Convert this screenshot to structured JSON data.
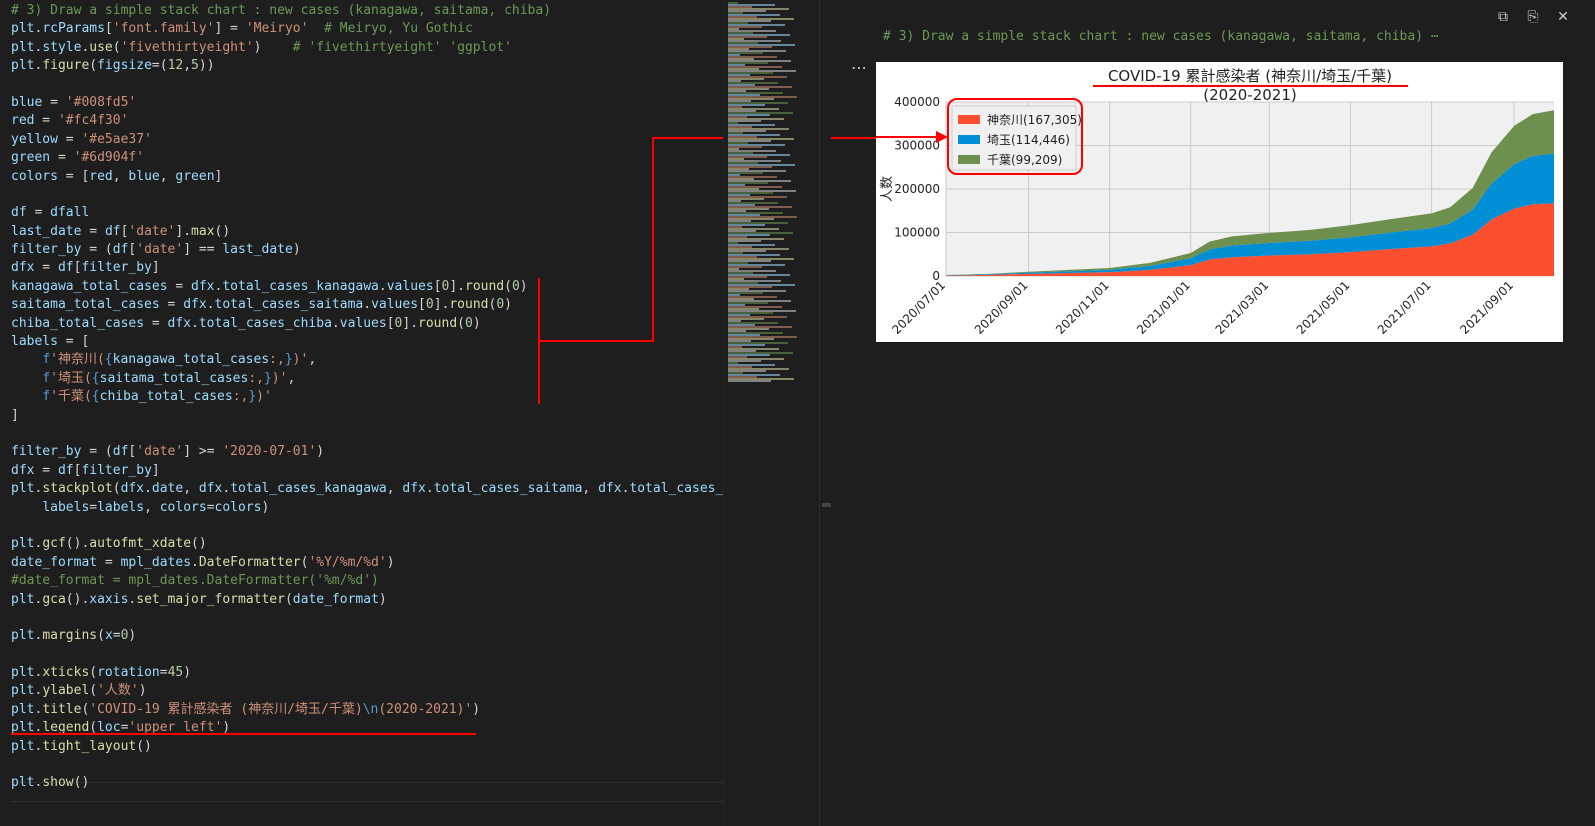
{
  "code": {
    "lines": [
      [
        [
          "# 3) Draw a simple stack chart : new cases (kanagawa, saitama, chiba)",
          "c"
        ]
      ],
      [
        [
          "plt",
          "v"
        ],
        [
          ".",
          ""
        ],
        [
          "rcParams",
          "v"
        ],
        [
          "[",
          "o"
        ],
        [
          "'font.family'",
          "s"
        ],
        [
          "] = ",
          ""
        ],
        [
          "'Meiryo'",
          "s"
        ],
        [
          "  ",
          ""
        ],
        [
          "# Meiryo, Yu Gothic",
          "c"
        ]
      ],
      [
        [
          "plt",
          "v"
        ],
        [
          ".",
          ""
        ],
        [
          "style",
          "v"
        ],
        [
          ".",
          ""
        ],
        [
          "use",
          "f"
        ],
        [
          "(",
          ""
        ],
        [
          "'fivethirtyeight'",
          "s"
        ],
        [
          ")    ",
          ""
        ],
        [
          "# 'fivethirtyeight' 'ggplot'",
          "c"
        ]
      ],
      [
        [
          "plt",
          "v"
        ],
        [
          ".",
          ""
        ],
        [
          "figure",
          "f"
        ],
        [
          "(",
          ""
        ],
        [
          "figsize",
          "v"
        ],
        [
          "=(",
          ""
        ],
        [
          "12",
          "n"
        ],
        [
          ",",
          ""
        ],
        [
          "5",
          "n"
        ],
        [
          "))",
          ""
        ]
      ],
      [],
      [
        [
          "blue",
          "v"
        ],
        [
          " = ",
          ""
        ],
        [
          "'#008fd5'",
          "s"
        ]
      ],
      [
        [
          "red",
          "v"
        ],
        [
          " = ",
          ""
        ],
        [
          "'#fc4f30'",
          "s"
        ]
      ],
      [
        [
          "yellow",
          "v"
        ],
        [
          " = ",
          ""
        ],
        [
          "'#e5ae37'",
          "s"
        ]
      ],
      [
        [
          "green",
          "v"
        ],
        [
          " = ",
          ""
        ],
        [
          "'#6d904f'",
          "s"
        ]
      ],
      [
        [
          "colors",
          "v"
        ],
        [
          " = [",
          ""
        ],
        [
          "red",
          "v"
        ],
        [
          ", ",
          ""
        ],
        [
          "blue",
          "v"
        ],
        [
          ", ",
          ""
        ],
        [
          "green",
          "v"
        ],
        [
          "]",
          ""
        ]
      ],
      [],
      [
        [
          "df",
          "v"
        ],
        [
          " = ",
          ""
        ],
        [
          "dfall",
          "v"
        ]
      ],
      [
        [
          "last_date",
          "v"
        ],
        [
          " = ",
          ""
        ],
        [
          "df",
          "v"
        ],
        [
          "[",
          ""
        ],
        [
          "'date'",
          "s"
        ],
        [
          "].",
          ""
        ],
        [
          "max",
          "f"
        ],
        [
          "()",
          ""
        ]
      ],
      [
        [
          "filter_by",
          "v"
        ],
        [
          " = (",
          ""
        ],
        [
          "df",
          "v"
        ],
        [
          "[",
          ""
        ],
        [
          "'date'",
          "s"
        ],
        [
          "] == ",
          ""
        ],
        [
          "last_date",
          "v"
        ],
        [
          ")",
          ""
        ]
      ],
      [
        [
          "dfx",
          "v"
        ],
        [
          " = ",
          ""
        ],
        [
          "df",
          "v"
        ],
        [
          "[",
          ""
        ],
        [
          "filter_by",
          "v"
        ],
        [
          "]",
          ""
        ]
      ],
      [
        [
          "kanagawa_total_cases",
          "v"
        ],
        [
          " = ",
          ""
        ],
        [
          "dfx",
          "v"
        ],
        [
          ".",
          ""
        ],
        [
          "total_cases_kanagawa",
          "v"
        ],
        [
          ".",
          ""
        ],
        [
          "values",
          "v"
        ],
        [
          "[",
          ""
        ],
        [
          "0",
          "n"
        ],
        [
          "].",
          ""
        ],
        [
          "round",
          "f"
        ],
        [
          "(",
          ""
        ],
        [
          "0",
          "n"
        ],
        [
          ")",
          ""
        ]
      ],
      [
        [
          "saitama_total_cases",
          "v"
        ],
        [
          " = ",
          ""
        ],
        [
          "dfx",
          "v"
        ],
        [
          ".",
          ""
        ],
        [
          "total_cases_saitama",
          "v"
        ],
        [
          ".",
          ""
        ],
        [
          "values",
          "v"
        ],
        [
          "[",
          ""
        ],
        [
          "0",
          "n"
        ],
        [
          "].",
          ""
        ],
        [
          "round",
          "f"
        ],
        [
          "(",
          ""
        ],
        [
          "0",
          "n"
        ],
        [
          ")",
          ""
        ]
      ],
      [
        [
          "chiba_total_cases",
          "v"
        ],
        [
          " = ",
          ""
        ],
        [
          "dfx",
          "v"
        ],
        [
          ".",
          ""
        ],
        [
          "total_cases_chiba",
          "v"
        ],
        [
          ".",
          ""
        ],
        [
          "values",
          "v"
        ],
        [
          "[",
          ""
        ],
        [
          "0",
          "n"
        ],
        [
          "].",
          ""
        ],
        [
          "round",
          "f"
        ],
        [
          "(",
          ""
        ],
        [
          "0",
          "n"
        ],
        [
          ")",
          ""
        ]
      ],
      [
        [
          "labels",
          "v"
        ],
        [
          " = [",
          ""
        ]
      ],
      [
        [
          "    ",
          ""
        ],
        [
          "f",
          "b"
        ],
        [
          "'神奈川(",
          "s"
        ],
        [
          "{",
          "b"
        ],
        [
          "kanagawa_total_cases",
          "v"
        ],
        [
          ":,",
          "s"
        ],
        [
          "}",
          "b"
        ],
        [
          ")'",
          "s"
        ],
        [
          ",",
          ""
        ]
      ],
      [
        [
          "    ",
          ""
        ],
        [
          "f",
          "b"
        ],
        [
          "'埼玉(",
          "s"
        ],
        [
          "{",
          "b"
        ],
        [
          "saitama_total_cases",
          "v"
        ],
        [
          ":,",
          "s"
        ],
        [
          "}",
          "b"
        ],
        [
          ")'",
          "s"
        ],
        [
          ",",
          ""
        ]
      ],
      [
        [
          "    ",
          ""
        ],
        [
          "f",
          "b"
        ],
        [
          "'千葉(",
          "s"
        ],
        [
          "{",
          "b"
        ],
        [
          "chiba_total_cases",
          "v"
        ],
        [
          ":,",
          "s"
        ],
        [
          "}",
          "b"
        ],
        [
          ")'",
          "s"
        ]
      ],
      [
        [
          "]",
          ""
        ]
      ],
      [],
      [
        [
          "filter_by",
          "v"
        ],
        [
          " = (",
          ""
        ],
        [
          "df",
          "v"
        ],
        [
          "[",
          ""
        ],
        [
          "'date'",
          "s"
        ],
        [
          "] >= ",
          ""
        ],
        [
          "'2020-07-01'",
          "s"
        ],
        [
          ")",
          ""
        ]
      ],
      [
        [
          "dfx",
          "v"
        ],
        [
          " = ",
          ""
        ],
        [
          "df",
          "v"
        ],
        [
          "[",
          ""
        ],
        [
          "filter_by",
          "v"
        ],
        [
          "]",
          ""
        ]
      ],
      [
        [
          "plt",
          "v"
        ],
        [
          ".",
          ""
        ],
        [
          "stackplot",
          "f"
        ],
        [
          "(",
          ""
        ],
        [
          "dfx",
          "v"
        ],
        [
          ".",
          ""
        ],
        [
          "date",
          "v"
        ],
        [
          ", ",
          ""
        ],
        [
          "dfx",
          "v"
        ],
        [
          ".",
          ""
        ],
        [
          "total_cases_kanagawa",
          "v"
        ],
        [
          ", ",
          ""
        ],
        [
          "dfx",
          "v"
        ],
        [
          ".",
          ""
        ],
        [
          "total_cases_saitama",
          "v"
        ],
        [
          ", ",
          ""
        ],
        [
          "dfx",
          "v"
        ],
        [
          ".",
          ""
        ],
        [
          "total_cases_chi",
          "v"
        ]
      ],
      [
        [
          "    ",
          ""
        ],
        [
          "labels",
          "v"
        ],
        [
          "=",
          ""
        ],
        [
          "labels",
          "v"
        ],
        [
          ", ",
          ""
        ],
        [
          "colors",
          "v"
        ],
        [
          "=",
          ""
        ],
        [
          "colors",
          "v"
        ],
        [
          ")",
          ""
        ]
      ],
      [],
      [
        [
          "plt",
          "v"
        ],
        [
          ".",
          ""
        ],
        [
          "gcf",
          "f"
        ],
        [
          "().",
          ""
        ],
        [
          "autofmt_xdate",
          "f"
        ],
        [
          "()",
          ""
        ]
      ],
      [
        [
          "date_format",
          "v"
        ],
        [
          " = ",
          ""
        ],
        [
          "mpl_dates",
          "v"
        ],
        [
          ".",
          ""
        ],
        [
          "DateFormatter",
          "f"
        ],
        [
          "(",
          ""
        ],
        [
          "'%Y/%m/%d'",
          "s"
        ],
        [
          ")",
          ""
        ]
      ],
      [
        [
          "#date_format = mpl_dates.DateFormatter('%m/%d')",
          "c"
        ]
      ],
      [
        [
          "plt",
          "v"
        ],
        [
          ".",
          ""
        ],
        [
          "gca",
          "f"
        ],
        [
          "().",
          ""
        ],
        [
          "xaxis",
          "v"
        ],
        [
          ".",
          ""
        ],
        [
          "set_major_formatter",
          "f"
        ],
        [
          "(",
          ""
        ],
        [
          "date_format",
          "v"
        ],
        [
          ")",
          ""
        ]
      ],
      [],
      [
        [
          "plt",
          "v"
        ],
        [
          ".",
          ""
        ],
        [
          "margins",
          "f"
        ],
        [
          "(",
          ""
        ],
        [
          "x",
          "v"
        ],
        [
          "=",
          ""
        ],
        [
          "0",
          "n"
        ],
        [
          ")",
          ""
        ]
      ],
      [],
      [
        [
          "plt",
          "v"
        ],
        [
          ".",
          ""
        ],
        [
          "xticks",
          "f"
        ],
        [
          "(",
          ""
        ],
        [
          "rotation",
          "v"
        ],
        [
          "=",
          ""
        ],
        [
          "45",
          "n"
        ],
        [
          ")",
          ""
        ]
      ],
      [
        [
          "plt",
          "v"
        ],
        [
          ".",
          ""
        ],
        [
          "ylabel",
          "f"
        ],
        [
          "(",
          ""
        ],
        [
          "'人数'",
          "s"
        ],
        [
          ")",
          ""
        ]
      ],
      [
        [
          "plt",
          "v"
        ],
        [
          ".",
          ""
        ],
        [
          "title",
          "f"
        ],
        [
          "(",
          ""
        ],
        [
          "'COVID-19 累計感染者 (神奈川/埼玉/千葉)",
          "s"
        ],
        [
          "\\n",
          "b"
        ],
        [
          "(2020-2021)'",
          "s"
        ],
        [
          ")",
          ""
        ]
      ],
      [
        [
          "plt",
          "v"
        ],
        [
          ".",
          ""
        ],
        [
          "legend",
          "f"
        ],
        [
          "(",
          ""
        ],
        [
          "loc",
          "v"
        ],
        [
          "=",
          ""
        ],
        [
          "'upper left'",
          "s"
        ],
        [
          ")",
          ""
        ]
      ],
      [
        [
          "plt",
          "v"
        ],
        [
          ".",
          ""
        ],
        [
          "tight_layout",
          "f"
        ],
        [
          "()",
          ""
        ]
      ],
      [],
      [
        [
          "plt",
          "v"
        ],
        [
          ".",
          ""
        ],
        [
          "show",
          "f"
        ],
        [
          "()",
          ""
        ]
      ]
    ]
  },
  "output": {
    "comment": "# 3) Draw a simple stack chart : new cases (kanagawa, saitama, chiba) ⋯",
    "more": "⋯",
    "toolbar": [
      "copy-icon",
      "paste-icon",
      "close-icon"
    ]
  },
  "colors": {
    "red": "#fc4f30",
    "blue": "#008fd5",
    "green": "#6d904f",
    "annot": "#ff0000"
  },
  "chart_data": {
    "type": "area",
    "title": "COVID-19 累計感染者 (神奈川/埼玉/千葉)",
    "subtitle": "(2020-2021)",
    "ylabel": "人数",
    "xlabel": "",
    "x": [
      "2020/07/01",
      "2020/08/01",
      "2020/09/01",
      "2020/10/01",
      "2020/11/01",
      "2020/12/01",
      "2021/01/01",
      "2021/01/15",
      "2021/02/01",
      "2021/03/01",
      "2021/04/01",
      "2021/05/01",
      "2021/06/01",
      "2021/07/01",
      "2021/07/15",
      "2021/08/01",
      "2021/08/15",
      "2021/09/01",
      "2021/09/15",
      "2021/10/01"
    ],
    "x_ticks": [
      "2020/07/01",
      "2020/09/01",
      "2020/11/01",
      "2021/01/01",
      "2021/03/01",
      "2021/05/01",
      "2021/07/01",
      "2021/09/01"
    ],
    "series": [
      {
        "name": "神奈川(167,305)",
        "color": "#fc4f30",
        "values": [
          1000,
          2500,
          5000,
          7000,
          9000,
          14000,
          25000,
          38000,
          43000,
          47000,
          50000,
          55000,
          62000,
          68000,
          75000,
          95000,
          130000,
          155000,
          165000,
          167305
        ]
      },
      {
        "name": "埼玉(114,446)",
        "color": "#008fd5",
        "values": [
          700,
          1500,
          2800,
          4000,
          5500,
          9000,
          16000,
          23000,
          27000,
          29000,
          31000,
          34000,
          38000,
          42000,
          46000,
          58000,
          82000,
          102000,
          111000,
          114446
        ]
      },
      {
        "name": "千葉(99,209)",
        "color": "#6d904f",
        "values": [
          500,
          1000,
          2000,
          3000,
          4000,
          7000,
          12000,
          18000,
          21000,
          23000,
          25000,
          28000,
          31000,
          34000,
          37000,
          50000,
          72000,
          88000,
          96000,
          99209
        ]
      }
    ],
    "ylim": [
      0,
      400000
    ],
    "yticks": [
      0,
      100000,
      200000,
      300000,
      400000
    ],
    "ytick_labels": [
      "0",
      "100000",
      "200000",
      "300000",
      "400000"
    ],
    "legend": "upper-left",
    "grid": true
  }
}
